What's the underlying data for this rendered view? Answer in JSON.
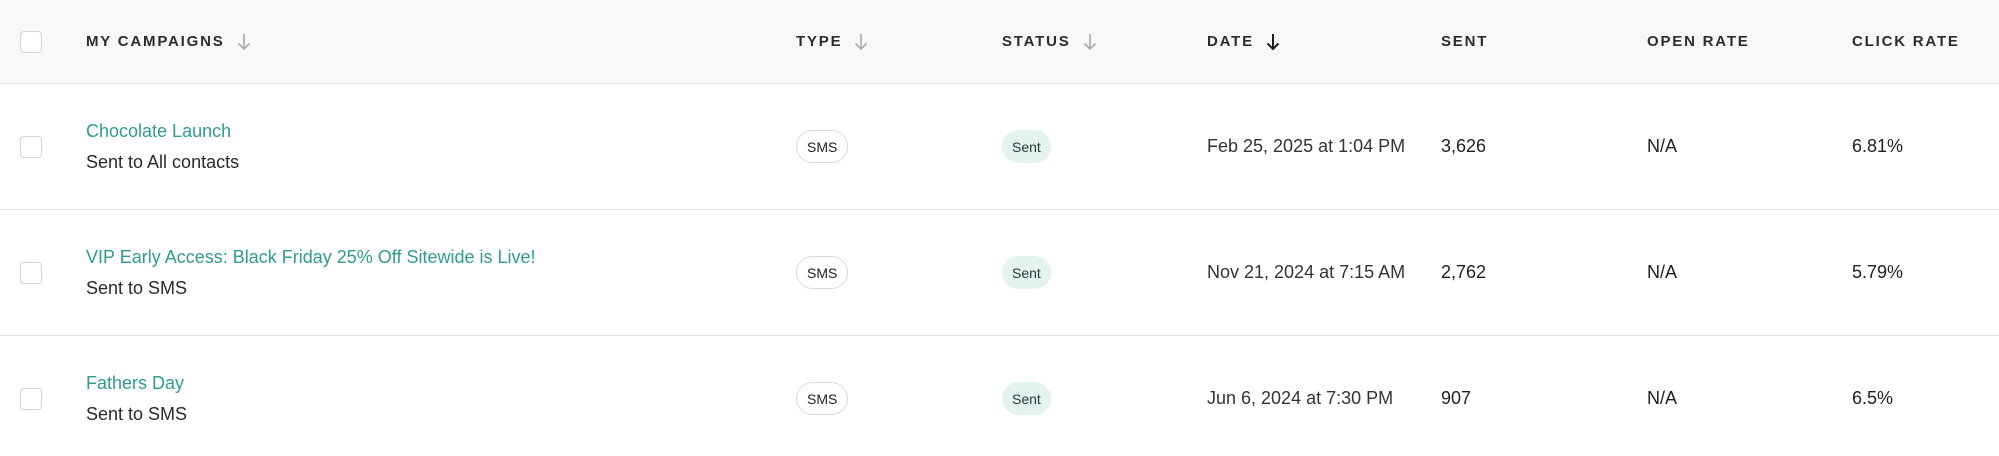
{
  "header": {
    "campaigns": "MY CAMPAIGNS",
    "type": "TYPE",
    "status": "STATUS",
    "date": "DATE",
    "sent": "SENT",
    "open_rate": "OPEN RATE",
    "click_rate": "CLICK RATE"
  },
  "sort": {
    "active_column": "date",
    "direction": "descending",
    "active_color": "#1f1f1f",
    "inactive_color": "#a6a9a8"
  },
  "colors": {
    "link": "#2f9c8f",
    "status_sent_bg": "#e3f4ef",
    "header_bg": "#f7f8f8"
  },
  "rows": [
    {
      "name": "Chocolate Launch",
      "audience": "Sent to All contacts",
      "type": "SMS",
      "status": "Sent",
      "date": "Feb 25, 2025 at 1:04 PM",
      "sent": "3,626",
      "open_rate": "N/A",
      "click_rate": "6.81%"
    },
    {
      "name": "VIP Early Access: Black Friday 25% Off Sitewide is Live!",
      "audience": "Sent to SMS",
      "type": "SMS",
      "status": "Sent",
      "date": "Nov 21, 2024 at 7:15 AM",
      "sent": "2,762",
      "open_rate": "N/A",
      "click_rate": "5.79%"
    },
    {
      "name": "Fathers Day",
      "audience": "Sent to SMS",
      "type": "SMS",
      "status": "Sent",
      "date": "Jun 6, 2024 at 7:30 PM",
      "sent": "907",
      "open_rate": "N/A",
      "click_rate": "6.5%"
    }
  ]
}
